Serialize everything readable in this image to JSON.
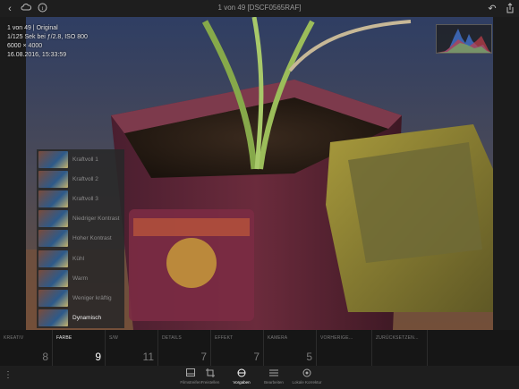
{
  "header": {
    "title": "1 von 49 [DSCF0565RAF]",
    "back_icon": "chevron-left-icon",
    "cloud_icon": "cloud-icon",
    "info_icon": "info-icon",
    "undo_icon": "undo-icon",
    "share_icon": "share-icon"
  },
  "info": {
    "line1": "1 von 49 | Original",
    "line2": "1/125 Sek bei ƒ/2.8, ISO 800",
    "line3": "6000 × 4000",
    "line4": "16.08.2016, 15:33:59"
  },
  "presets": [
    {
      "label": "Kraftvoll 1",
      "selected": false
    },
    {
      "label": "Kraftvoll 2",
      "selected": false
    },
    {
      "label": "Kraftvoll 3",
      "selected": false
    },
    {
      "label": "Niedriger Kontrast",
      "selected": false
    },
    {
      "label": "Hoher Kontrast",
      "selected": false
    },
    {
      "label": "Kühl",
      "selected": false
    },
    {
      "label": "Warm",
      "selected": false
    },
    {
      "label": "Weniger kräftig",
      "selected": false
    },
    {
      "label": "Dynamisch",
      "selected": true
    }
  ],
  "categories": [
    {
      "label": "KREATIV",
      "value": "8",
      "active": false
    },
    {
      "label": "FARBE",
      "value": "9",
      "active": true
    },
    {
      "label": "S/W",
      "value": "11",
      "active": false
    },
    {
      "label": "DETAILS",
      "value": "7",
      "active": false
    },
    {
      "label": "EFFEKT",
      "value": "7",
      "active": false
    },
    {
      "label": "KAMERA",
      "value": "5",
      "active": false
    },
    {
      "label": "VORHERIGE...",
      "value": "",
      "active": false
    },
    {
      "label": "ZURÜCKSETZEN...",
      "value": "",
      "active": false
    }
  ],
  "toolbar": {
    "items": [
      {
        "label": "Filmstreifen",
        "icon": "filmstrip-icon",
        "active": false
      },
      {
        "label": "Freistellen",
        "icon": "crop-icon",
        "active": false
      },
      {
        "label": "Vorgaben",
        "icon": "presets-icon",
        "active": true
      },
      {
        "label": "Bearbeiten",
        "icon": "sliders-icon",
        "active": false
      },
      {
        "label": "Lokale Korrektur",
        "icon": "brush-icon",
        "active": false
      }
    ],
    "menu_icon": "more-vertical-icon"
  },
  "colors": {
    "accent": "#ffffff",
    "background": "#1b1b1b"
  }
}
